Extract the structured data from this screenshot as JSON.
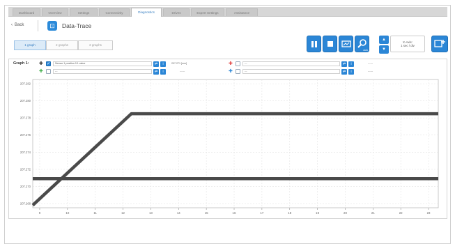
{
  "tabs": [
    {
      "label": "Dashboard",
      "active": false
    },
    {
      "label": "Overview",
      "active": false
    },
    {
      "label": "Settings",
      "active": false
    },
    {
      "label": "Connectivity",
      "active": false
    },
    {
      "label": "Diagnostics",
      "active": true
    },
    {
      "label": "Drives",
      "active": false
    },
    {
      "label": "Expert Settings",
      "active": false
    },
    {
      "label": "Assistance",
      "active": false
    }
  ],
  "header": {
    "back_label": "Back",
    "title": "Data-Trace"
  },
  "view_toggle": [
    {
      "label": "1 graph",
      "active": true
    },
    {
      "label": "2 graphs",
      "active": false
    },
    {
      "label": "3 graphs",
      "active": false
    }
  ],
  "toolbar": {
    "icons": [
      "pause-icon",
      "stop-icon",
      "record-icon",
      "zoom-icon",
      "add-graph-icon"
    ],
    "zoom_caption": "auto",
    "x_axis_label": "X-Axis:",
    "x_axis_value": "1 sec / div"
  },
  "graph": {
    "label": "Graph 1:",
    "channels": [
      {
        "color": "#222222",
        "checked": true,
        "signal": "Sensor 1 position 0.1 value",
        "value": "207.271 [mm]"
      },
      {
        "color": "#e03b3b",
        "checked": false,
        "signal": "---",
        "value": "------"
      },
      {
        "color": "#3fae49",
        "checked": false,
        "signal": "---",
        "value": "------"
      },
      {
        "color": "#2b86d6",
        "checked": false,
        "signal": "---",
        "value": "------"
      }
    ]
  },
  "chart_data": {
    "type": "line",
    "title": "",
    "xlabel": "",
    "ylabel": "",
    "x_ticks": [
      9,
      10,
      11,
      12,
      13,
      14,
      15,
      16,
      17,
      18,
      19,
      20,
      21,
      22,
      23
    ],
    "y_ticks": [
      "207.268",
      "207.270",
      "207.272",
      "207.274",
      "207.276",
      "207.278",
      "207.280",
      "207.282"
    ],
    "xlim": [
      8.75,
      23.35
    ],
    "ylim": [
      207.2675,
      207.2825
    ],
    "grid": true,
    "series": [
      {
        "color": "#4a4a4a",
        "x": [
          8.75,
          12.3,
          23.35
        ],
        "y": [
          207.2678,
          207.2785,
          207.2785
        ]
      },
      {
        "color": "#4a4a4a",
        "x": [
          8.75,
          23.35
        ],
        "y": [
          207.2709,
          207.2709
        ]
      }
    ]
  }
}
